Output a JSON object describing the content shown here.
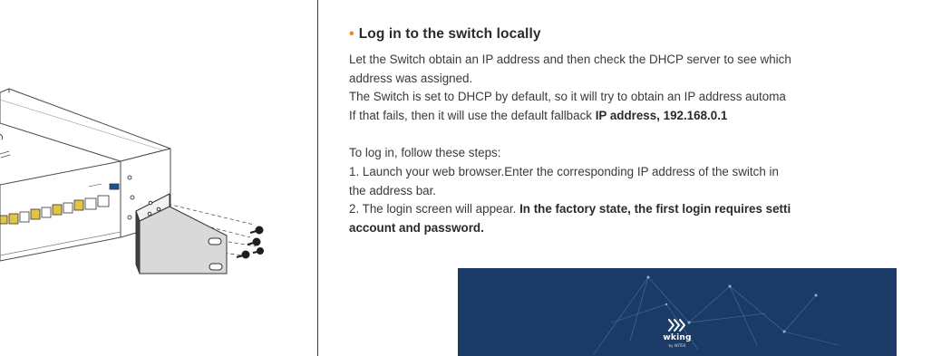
{
  "heading": "Log in to the switch locally",
  "paragraphs": {
    "p1_line1": "Let the Switch obtain an IP address and then check the DHCP server to see which",
    "p1_line2": "address was assigned.",
    "p2_line1": "The Switch is set to DHCP by default, so it will try to obtain an IP address automa",
    "p2_line2_prefix": "If that fails, then it will use the default fallback ",
    "p2_line2_bold": "IP address, 192.168.0.1",
    "steps_intro": "To log in, follow these steps:",
    "step1_line1": "1. Launch your web browser.Enter the corresponding IP address of the switch in",
    "step1_line2": "the address bar.",
    "step2_prefix": "2. The login screen will appear. ",
    "step2_bold_line1": "In the factory state, the first login requires setti",
    "step2_bold_line2": "account and password."
  },
  "logo": {
    "brand": "wking",
    "sub": "by WITEK"
  },
  "colors": {
    "accent": "#f08a1c",
    "banner": "#1c3a66",
    "text": "#3a3a3a"
  }
}
